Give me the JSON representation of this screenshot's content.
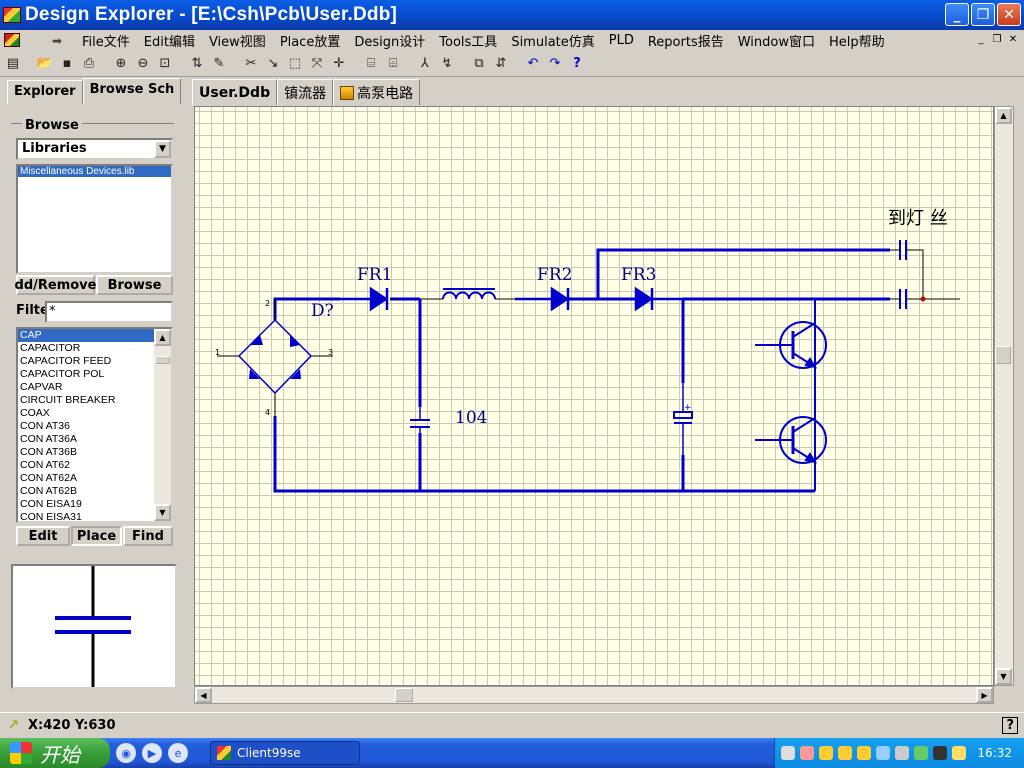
{
  "window": {
    "title": "Design Explorer - [E:\\Csh\\Pcb\\User.Ddb]",
    "min": "_",
    "max": "❐",
    "close": "✕"
  },
  "menu": [
    "File文件",
    "Edit编辑",
    "View视图",
    "Place放置",
    "Design设计",
    "Tools工具",
    "Simulate仿真",
    "PLD",
    "Reports报告",
    "Window窗口",
    "Help帮助"
  ],
  "panel": {
    "tabs": [
      "Explorer",
      "Browse Sch"
    ],
    "browse_label": "Browse",
    "browse_value": "Libraries",
    "libraries": [
      "Miscellaneous Devices.lib"
    ],
    "add_remove": "dd/Remove",
    "browse_btn": "Browse",
    "filter_label": "Filte",
    "filter_value": "*",
    "components": [
      "CAP",
      "CAPACITOR",
      "CAPACITOR FEED",
      "CAPACITOR POL",
      "CAPVAR",
      "CIRCUIT BREAKER",
      "COAX",
      "CON AT36",
      "CON AT36A",
      "CON AT36B",
      "CON AT62",
      "CON AT62A",
      "CON AT62B",
      "CON EISA19",
      "CON EISA31"
    ],
    "edit_btn": "Edit",
    "place_btn": "Place",
    "find_btn": "Find"
  },
  "doc_tabs": [
    "User.Ddb",
    "镇流器",
    "高泵电路"
  ],
  "schematic": {
    "labels": {
      "fr1": "FR1",
      "fr2": "FR2",
      "fr3": "FR3",
      "designator": "D?",
      "cap_value": "104",
      "lamp": "到灯 丝"
    },
    "pins": {
      "p1": "1",
      "p2": "2",
      "p3": "3",
      "p4": "4"
    },
    "wire_color": "#0000cc",
    "grid_color": "#ffffe6"
  },
  "status": {
    "coords": "X:420 Y:630"
  },
  "taskbar": {
    "start": "开始",
    "task": "Client99se",
    "time": "16:32"
  }
}
